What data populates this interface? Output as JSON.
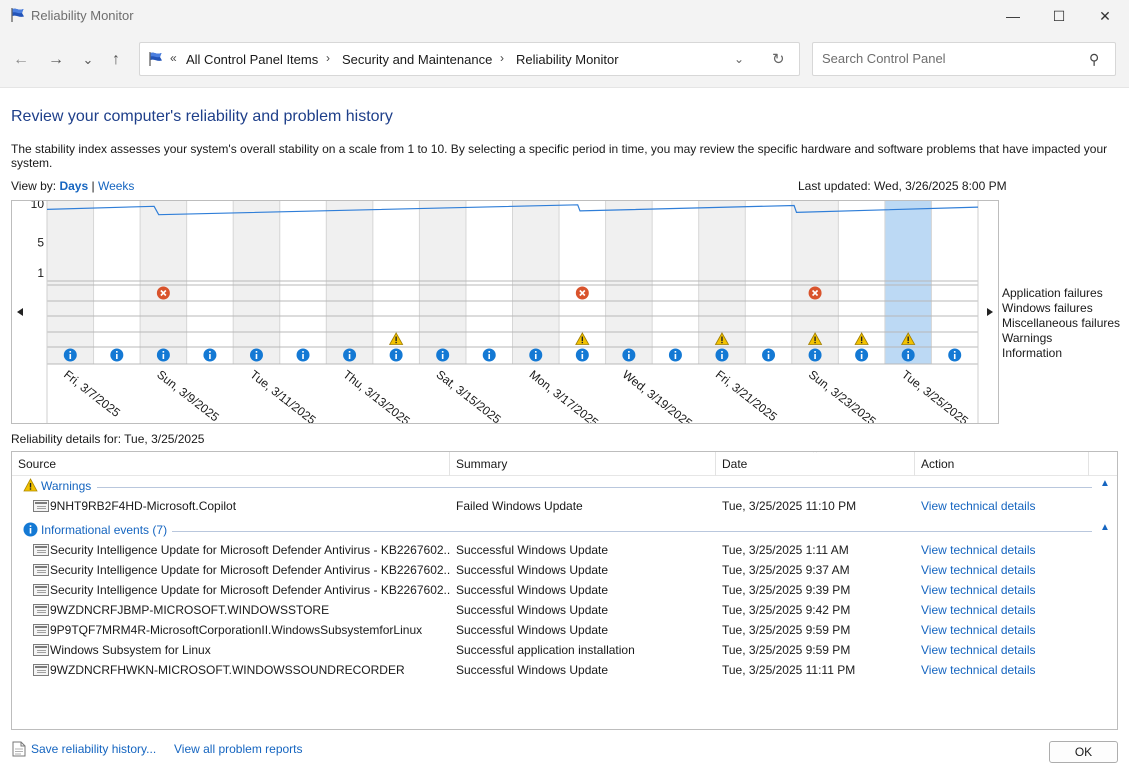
{
  "window": {
    "title": "Reliability Monitor",
    "minimize_glyph": "—",
    "maximize_glyph": "☐",
    "close_glyph": "✕"
  },
  "nav": {
    "back_glyph": "←",
    "forward_glyph": "→",
    "recent_glyph": "⌄",
    "up_glyph": "↑",
    "chevrons": "«",
    "breadcrumb": [
      "All Control Panel Items",
      "Security and Maintenance",
      "Reliability Monitor"
    ],
    "separator": "›",
    "dropdown_glyph": "⌄",
    "refresh_glyph": "↻",
    "search_placeholder": "Search Control Panel",
    "search_glyph": "⚲"
  },
  "page": {
    "heading": "Review your computer's reliability and problem history",
    "description": "The stability index assesses your system's overall stability on a scale from 1 to 10. By selecting a specific period in time, you may review the specific hardware and software problems that have impacted your system.",
    "view_by_label": "View by: ",
    "view_days": "Days",
    "view_sep": " | ",
    "view_weeks": "Weeks",
    "last_updated": "Last updated: Wed, 3/26/2025 8:00 PM",
    "details_for": "Reliability details for: Tue, 3/25/2025"
  },
  "chart_data": {
    "type": "line",
    "y_ticks": [
      "10",
      "5",
      "1"
    ],
    "ylim": [
      1,
      10
    ],
    "dates": [
      "Fri, 3/7/2025",
      "Sat, 3/8/2025",
      "Sun, 3/9/2025",
      "Mon, 3/10/2025",
      "Tue, 3/11/2025",
      "Wed, 3/12/2025",
      "Thu, 3/13/2025",
      "Fri, 3/14/2025",
      "Sat, 3/15/2025",
      "Sun, 3/16/2025",
      "Mon, 3/17/2025",
      "Tue, 3/18/2025",
      "Wed, 3/19/2025",
      "Thu, 3/20/2025",
      "Fri, 3/21/2025",
      "Sat, 3/22/2025",
      "Sun, 3/23/2025",
      "Mon, 3/24/2025",
      "Tue, 3/25/2025",
      "Wed, 3/26/2025"
    ],
    "date_labels": [
      "Fri, 3/7/2025",
      "Sun, 3/9/2025",
      "Tue, 3/11/2025",
      "Thu, 3/13/2025",
      "Sat, 3/15/2025",
      "Mon, 3/17/2025",
      "Wed, 3/19/2025",
      "Fri, 3/21/2025",
      "Sun, 3/23/2025",
      "Tue, 3/25/2025"
    ],
    "stability_points": [
      [
        0,
        9.3
      ],
      [
        2.3,
        9.7
      ],
      [
        2.4,
        8.6
      ],
      [
        11.4,
        9.9
      ],
      [
        11.45,
        9.1
      ],
      [
        16.05,
        9.8
      ],
      [
        16.1,
        8.9
      ],
      [
        20,
        9.6
      ]
    ],
    "selected_index": 18,
    "legend": [
      "Application failures",
      "Windows failures",
      "Miscellaneous failures",
      "Warnings",
      "Information"
    ],
    "application_failures": [
      2,
      11,
      16
    ],
    "windows_failures": [],
    "miscellaneous_failures": [],
    "warnings": [
      7,
      11,
      14,
      16,
      17,
      18
    ],
    "information": [
      0,
      1,
      2,
      3,
      4,
      5,
      6,
      7,
      8,
      9,
      10,
      11,
      12,
      13,
      14,
      15,
      16,
      17,
      18,
      19
    ]
  },
  "table": {
    "headers": {
      "source": "Source",
      "summary": "Summary",
      "date": "Date",
      "action": "Action"
    },
    "sort_glyph": "⌃",
    "collapse_glyph": "▲",
    "groups": [
      {
        "label": "Warnings",
        "icon": "warning-icon",
        "rows": [
          {
            "source": "9NHT9RB2F4HD-Microsoft.Copilot",
            "summary": "Failed Windows Update",
            "date": "Tue, 3/25/2025 11:10 PM",
            "action": "View technical details"
          }
        ]
      },
      {
        "label": "Informational events (7)",
        "icon": "info-icon",
        "rows": [
          {
            "source": "Security Intelligence Update for Microsoft Defender Antivirus - KB2267602...",
            "summary": "Successful Windows Update",
            "date": "Tue, 3/25/2025 1:11 AM",
            "action": "View technical details"
          },
          {
            "source": "Security Intelligence Update for Microsoft Defender Antivirus - KB2267602...",
            "summary": "Successful Windows Update",
            "date": "Tue, 3/25/2025 9:37 AM",
            "action": "View technical details"
          },
          {
            "source": "Security Intelligence Update for Microsoft Defender Antivirus - KB2267602...",
            "summary": "Successful Windows Update",
            "date": "Tue, 3/25/2025 9:39 PM",
            "action": "View technical details"
          },
          {
            "source": "9WZDNCRFJBMP-MICROSOFT.WINDOWSSTORE",
            "summary": "Successful Windows Update",
            "date": "Tue, 3/25/2025 9:42 PM",
            "action": "View technical details"
          },
          {
            "source": "9P9TQF7MRM4R-MicrosoftCorporationII.WindowsSubsystemforLinux",
            "summary": "Successful Windows Update",
            "date": "Tue, 3/25/2025 9:59 PM",
            "action": "View technical details"
          },
          {
            "source": "Windows Subsystem for Linux",
            "summary": "Successful application installation",
            "date": "Tue, 3/25/2025 9:59 PM",
            "action": "View technical details"
          },
          {
            "source": "9WZDNCRFHWKN-MICROSOFT.WINDOWSSOUNDRECORDER",
            "summary": "Successful Windows Update",
            "date": "Tue, 3/25/2025 11:11 PM",
            "action": "View technical details"
          }
        ]
      }
    ]
  },
  "footer": {
    "save_history": "Save reliability history...",
    "view_all": "View all problem reports",
    "ok": "OK"
  },
  "colors": {
    "accent": "#1565c0",
    "heading": "#1e3f8a",
    "error": "#d9532c",
    "warning": "#f2c200",
    "info": "#1479d4",
    "selected_column": "#bcd9f4",
    "stability_line": "#2f7ed8"
  }
}
